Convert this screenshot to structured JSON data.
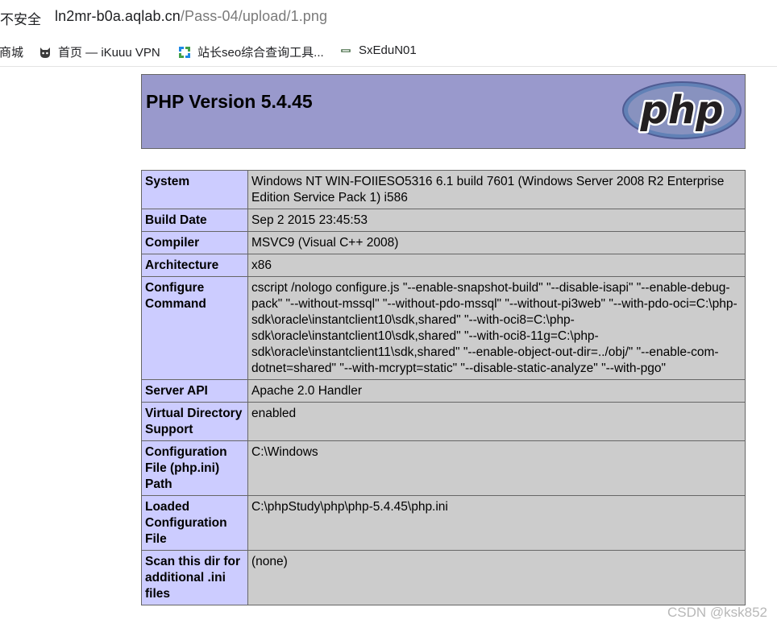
{
  "browser": {
    "security_label": "不安全",
    "url_host": "ln2mr-b0a.aqlab.cn",
    "url_path": "/Pass-04/upload/1.png"
  },
  "bookmarks": [
    {
      "label": "东商城",
      "icon": "partial-cut-off"
    },
    {
      "label": "首页 — iKuuu VPN",
      "icon": "cat-icon"
    },
    {
      "label": "站长seo综合查询工具...",
      "icon": "seo-tool-icon"
    },
    {
      "label": "SxEduN01",
      "icon": "sx-site-icon"
    }
  ],
  "php": {
    "title": "PHP Version 5.4.45",
    "logo_text": "php"
  },
  "rows": [
    {
      "key": "System",
      "value": "Windows NT WIN-FOIIESO5316 6.1 build 7601 (Windows Server 2008 R2 Enterprise Edition Service Pack 1) i586"
    },
    {
      "key": "Build Date",
      "value": "Sep 2 2015 23:45:53"
    },
    {
      "key": "Compiler",
      "value": "MSVC9 (Visual C++ 2008)"
    },
    {
      "key": "Architecture",
      "value": "x86"
    },
    {
      "key": "Configure Command",
      "value": "cscript /nologo configure.js \"--enable-snapshot-build\" \"--disable-isapi\" \"--enable-debug-pack\" \"--without-mssql\" \"--without-pdo-mssql\" \"--without-pi3web\" \"--with-pdo-oci=C:\\php-sdk\\oracle\\instantclient10\\sdk,shared\" \"--with-oci8=C:\\php-sdk\\oracle\\instantclient10\\sdk,shared\" \"--with-oci8-11g=C:\\php-sdk\\oracle\\instantclient11\\sdk,shared\" \"--enable-object-out-dir=../obj/\" \"--enable-com-dotnet=shared\" \"--with-mcrypt=static\" \"--disable-static-analyze\" \"--with-pgo\""
    },
    {
      "key": "Server API",
      "value": "Apache 2.0 Handler"
    },
    {
      "key": "Virtual Directory Support",
      "value": "enabled"
    },
    {
      "key": "Configuration File (php.ini) Path",
      "value": "C:\\Windows"
    },
    {
      "key": "Loaded Configuration File",
      "value": "C:\\phpStudy\\php\\php-5.4.45\\php.ini"
    },
    {
      "key": "Scan this dir for additional .ini files",
      "value": "(none)"
    }
  ],
  "watermark": "CSDN @ksk852"
}
